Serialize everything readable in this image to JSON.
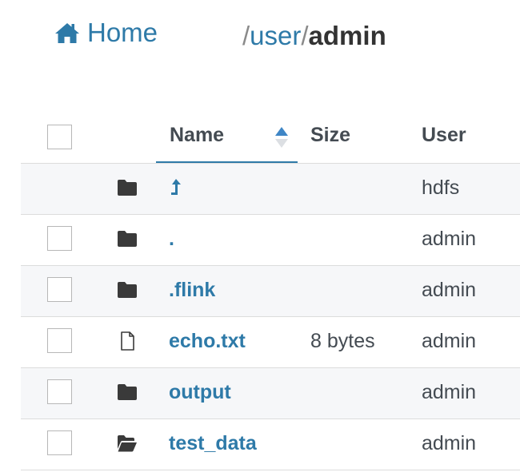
{
  "breadcrumb": {
    "home_label": "Home",
    "path_sep": "/",
    "path_segments": [
      {
        "label": "user"
      },
      {
        "label": "admin"
      }
    ]
  },
  "table": {
    "columns": {
      "name": "Name",
      "size": "Size",
      "user": "User"
    },
    "sort": {
      "column": "Name",
      "direction": "ascending"
    },
    "rows": [
      {
        "type": "parent",
        "icon": "folder-icon",
        "name": "",
        "size": "",
        "user": "hdfs"
      },
      {
        "type": "folder",
        "icon": "folder-icon",
        "name": ".",
        "size": "",
        "user": "admin"
      },
      {
        "type": "folder",
        "icon": "folder-icon",
        "name": ".flink",
        "size": "",
        "user": "admin"
      },
      {
        "type": "file",
        "icon": "file-icon",
        "name": "echo.txt",
        "size": "8 bytes",
        "user": "admin"
      },
      {
        "type": "folder",
        "icon": "folder-icon",
        "name": "output",
        "size": "",
        "user": "admin"
      },
      {
        "type": "folder-open",
        "icon": "folder-open-icon",
        "name": "test_data",
        "size": "",
        "user": "admin"
      }
    ]
  },
  "colors": {
    "link": "#2e7aa8",
    "text": "#444b52",
    "row_shade": "#f6f7f9",
    "border": "#dcdcdc"
  }
}
